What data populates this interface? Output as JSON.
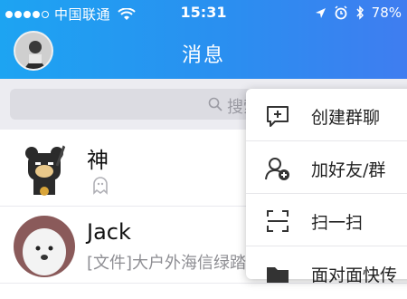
{
  "status_bar": {
    "carrier": "中国联通",
    "time": "15:31",
    "battery": "78%"
  },
  "header": {
    "title": "消息"
  },
  "search": {
    "placeholder": "搜索"
  },
  "conversations": [
    {
      "name": "神",
      "subtitle": ""
    },
    {
      "name": "Jack",
      "subtitle": "[文件]大户外海信绿踏"
    }
  ],
  "popup_menu": {
    "items": [
      {
        "label": "创建群聊",
        "icon": "chat-add-icon"
      },
      {
        "label": "加好友/群",
        "icon": "add-friend-icon"
      },
      {
        "label": "扫一扫",
        "icon": "scan-icon"
      },
      {
        "label": "面对面快传",
        "icon": "folder-transfer-icon"
      }
    ]
  },
  "colors": {
    "header_start": "#1da4f2",
    "header_end": "#3f7df0",
    "search_bg": "#ececf1"
  }
}
